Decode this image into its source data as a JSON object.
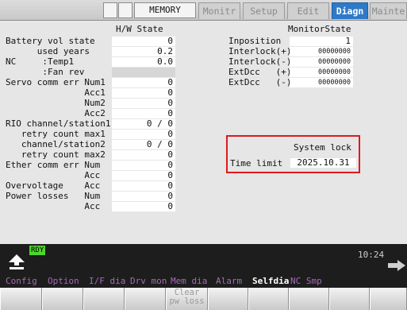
{
  "header": {
    "mode": "MEMORY",
    "tabs": [
      {
        "label": "Monitr",
        "active": false
      },
      {
        "label": "Setup",
        "active": false
      },
      {
        "label": "Edit",
        "active": false
      },
      {
        "label": "Diagn",
        "active": true
      },
      {
        "label": "Mainte",
        "active": false
      }
    ]
  },
  "hw_state": {
    "title": "H/W State",
    "rows": [
      {
        "label": "Battery vol state",
        "value": "0"
      },
      {
        "label": "      used years",
        "value": "0.2"
      },
      {
        "label": "NC     :Temp1",
        "value": "0.0"
      },
      {
        "label": "       :Fan rev",
        "value": ""
      },
      {
        "label": "Servo comm err Num1",
        "value": "0"
      },
      {
        "label": "               Acc1",
        "value": "0"
      },
      {
        "label": "               Num2",
        "value": "0"
      },
      {
        "label": "               Acc2",
        "value": "0"
      },
      {
        "label": "RIO channel/station1",
        "value": "0 / 0"
      },
      {
        "label": "   retry count max1",
        "value": "0"
      },
      {
        "label": "   channel/station2",
        "value": "0 / 0"
      },
      {
        "label": "   retry count max2",
        "value": "0"
      },
      {
        "label": "Ether comm err Num",
        "value": "0"
      },
      {
        "label": "               Acc",
        "value": "0"
      },
      {
        "label": "Overvoltage    Acc",
        "value": "0"
      },
      {
        "label": "Power losses   Num",
        "value": "0"
      },
      {
        "label": "               Acc",
        "value": "0"
      }
    ]
  },
  "monitor_state": {
    "title": "MonitorState",
    "rows": [
      {
        "label": "Inposition",
        "value": "1"
      },
      {
        "label": "Interlock(+)",
        "value": "00000000"
      },
      {
        "label": "Interlock(-)",
        "value": "00000000"
      },
      {
        "label": "ExtDcc   (+)",
        "value": "00000000"
      },
      {
        "label": "ExtDcc   (-)",
        "value": "00000000"
      }
    ]
  },
  "system_lock": {
    "title": "System lock",
    "time_limit_label": "Time limit",
    "time_limit_value": "2025.10.31"
  },
  "status": {
    "ready": "RDY",
    "clock": "10:24"
  },
  "menu": [
    {
      "label": "Config",
      "selected": false
    },
    {
      "label": "Option",
      "selected": false
    },
    {
      "label": "I/F dia",
      "selected": false
    },
    {
      "label": "Drv mon",
      "selected": false
    },
    {
      "label": "Mem dia",
      "selected": false
    },
    {
      "label": "Alarm",
      "selected": false
    },
    {
      "label": "Selfdia",
      "selected": true
    },
    {
      "label": "NC Smp",
      "selected": false
    }
  ],
  "function_keys": {
    "clear_line1": "Clear",
    "clear_line2": "pw loss"
  },
  "colors": {
    "active_tab": "#2f79c8",
    "ready_indicator": "#4dd62b",
    "highlight_frame": "#e0191e",
    "menu_text": "#a66ab6"
  }
}
